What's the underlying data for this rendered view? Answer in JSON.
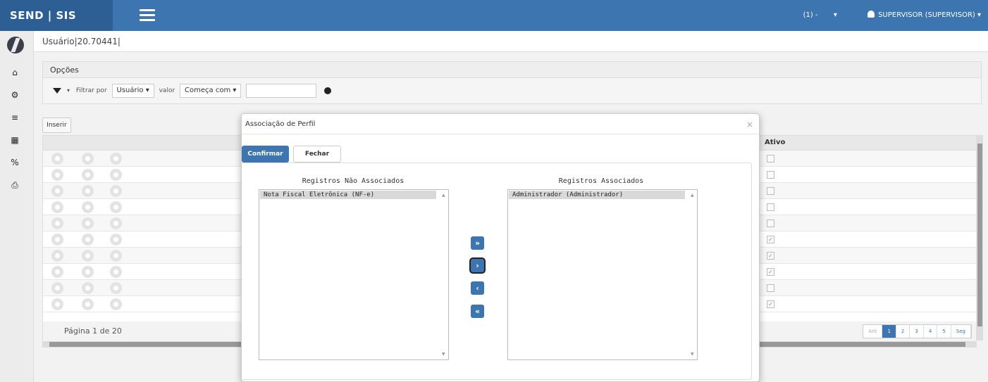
{
  "app": {
    "brand": "SEND | SIS"
  },
  "header": {
    "company_label": "(1) -",
    "user_label": "SUPERVISOR (SUPERVISOR)"
  },
  "breadcrumb": {
    "text": "Usuário|20.70441|"
  },
  "options": {
    "title": "Opções",
    "filter_by_label": "Filtrar por",
    "filter_field": "Usuário",
    "value_label": "valor",
    "filter_operator": "Começa com",
    "filter_value": ""
  },
  "toolbar": {
    "insert_label": "Inserir"
  },
  "grid": {
    "header_ativo": "Ativo",
    "rows": [
      {
        "ativo": false
      },
      {
        "ativo": false
      },
      {
        "ativo": false
      },
      {
        "ativo": false
      },
      {
        "ativo": false
      },
      {
        "ativo": true
      },
      {
        "ativo": true
      },
      {
        "ativo": true
      },
      {
        "ativo": false
      },
      {
        "ativo": true
      }
    ],
    "page_text": "Página 1 de 20",
    "pager": [
      "Ant",
      "1",
      "2",
      "3",
      "4",
      "5",
      "Seg"
    ],
    "current_page": "1"
  },
  "modal": {
    "title": "Associação de Perfil",
    "close_symbol": "×",
    "confirm_label": "Confirmar",
    "close_label": "Fechar",
    "left_title": "Registros Não Associados",
    "right_title": "Registros Associados",
    "left_items": [
      "Nota Fiscal Eletrônica (NF-e)"
    ],
    "right_items": [
      "Administrador (Administrador)"
    ],
    "move_buttons": [
      "»",
      "›",
      "‹",
      "«"
    ]
  }
}
